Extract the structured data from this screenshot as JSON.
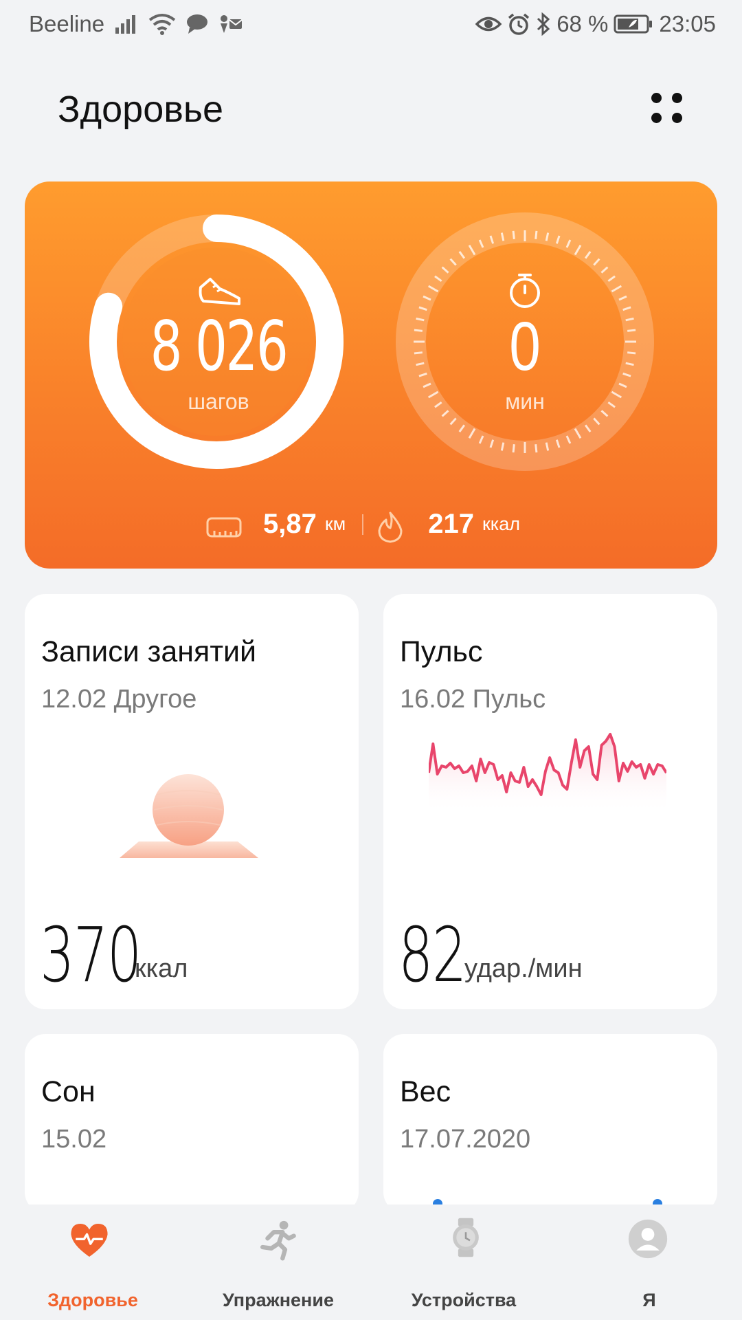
{
  "status_bar": {
    "carrier": "Beeline",
    "battery": "68 %",
    "time": "23:05"
  },
  "header": {
    "title": "Здоровье"
  },
  "activity": {
    "steps_value": "8 026",
    "steps_unit": "шагов",
    "steps_goal_fraction": 0.8,
    "minutes_value": "0",
    "minutes_unit": "мин",
    "distance_value": "5,87",
    "distance_unit": "км",
    "calories_value": "217",
    "calories_unit": "ккал"
  },
  "cards": {
    "workouts": {
      "title": "Записи занятий",
      "subtitle": "12.02 Другое",
      "value": "370",
      "unit": "ккал"
    },
    "pulse": {
      "title": "Пульс",
      "subtitle": "16.02 Пульс",
      "value": "82",
      "unit": "удар./мин"
    },
    "sleep": {
      "title": "Сон",
      "subtitle": "15.02"
    },
    "weight": {
      "title": "Вес",
      "subtitle": "17.07.2020"
    }
  },
  "bottom_nav": {
    "items": [
      {
        "label": "Здоровье",
        "icon": "heart-pulse-icon",
        "active": true
      },
      {
        "label": "Упражнение",
        "icon": "running-person-icon",
        "active": false
      },
      {
        "label": "Устройства",
        "icon": "watch-icon",
        "active": false
      },
      {
        "label": "Я",
        "icon": "profile-icon",
        "active": false
      }
    ]
  },
  "colors": {
    "accent": "#f1632d",
    "activity_top": "#ff9c2e",
    "activity_bottom": "#f46c28",
    "pulse_line": "#e8456b",
    "background": "#f2f3f5"
  }
}
